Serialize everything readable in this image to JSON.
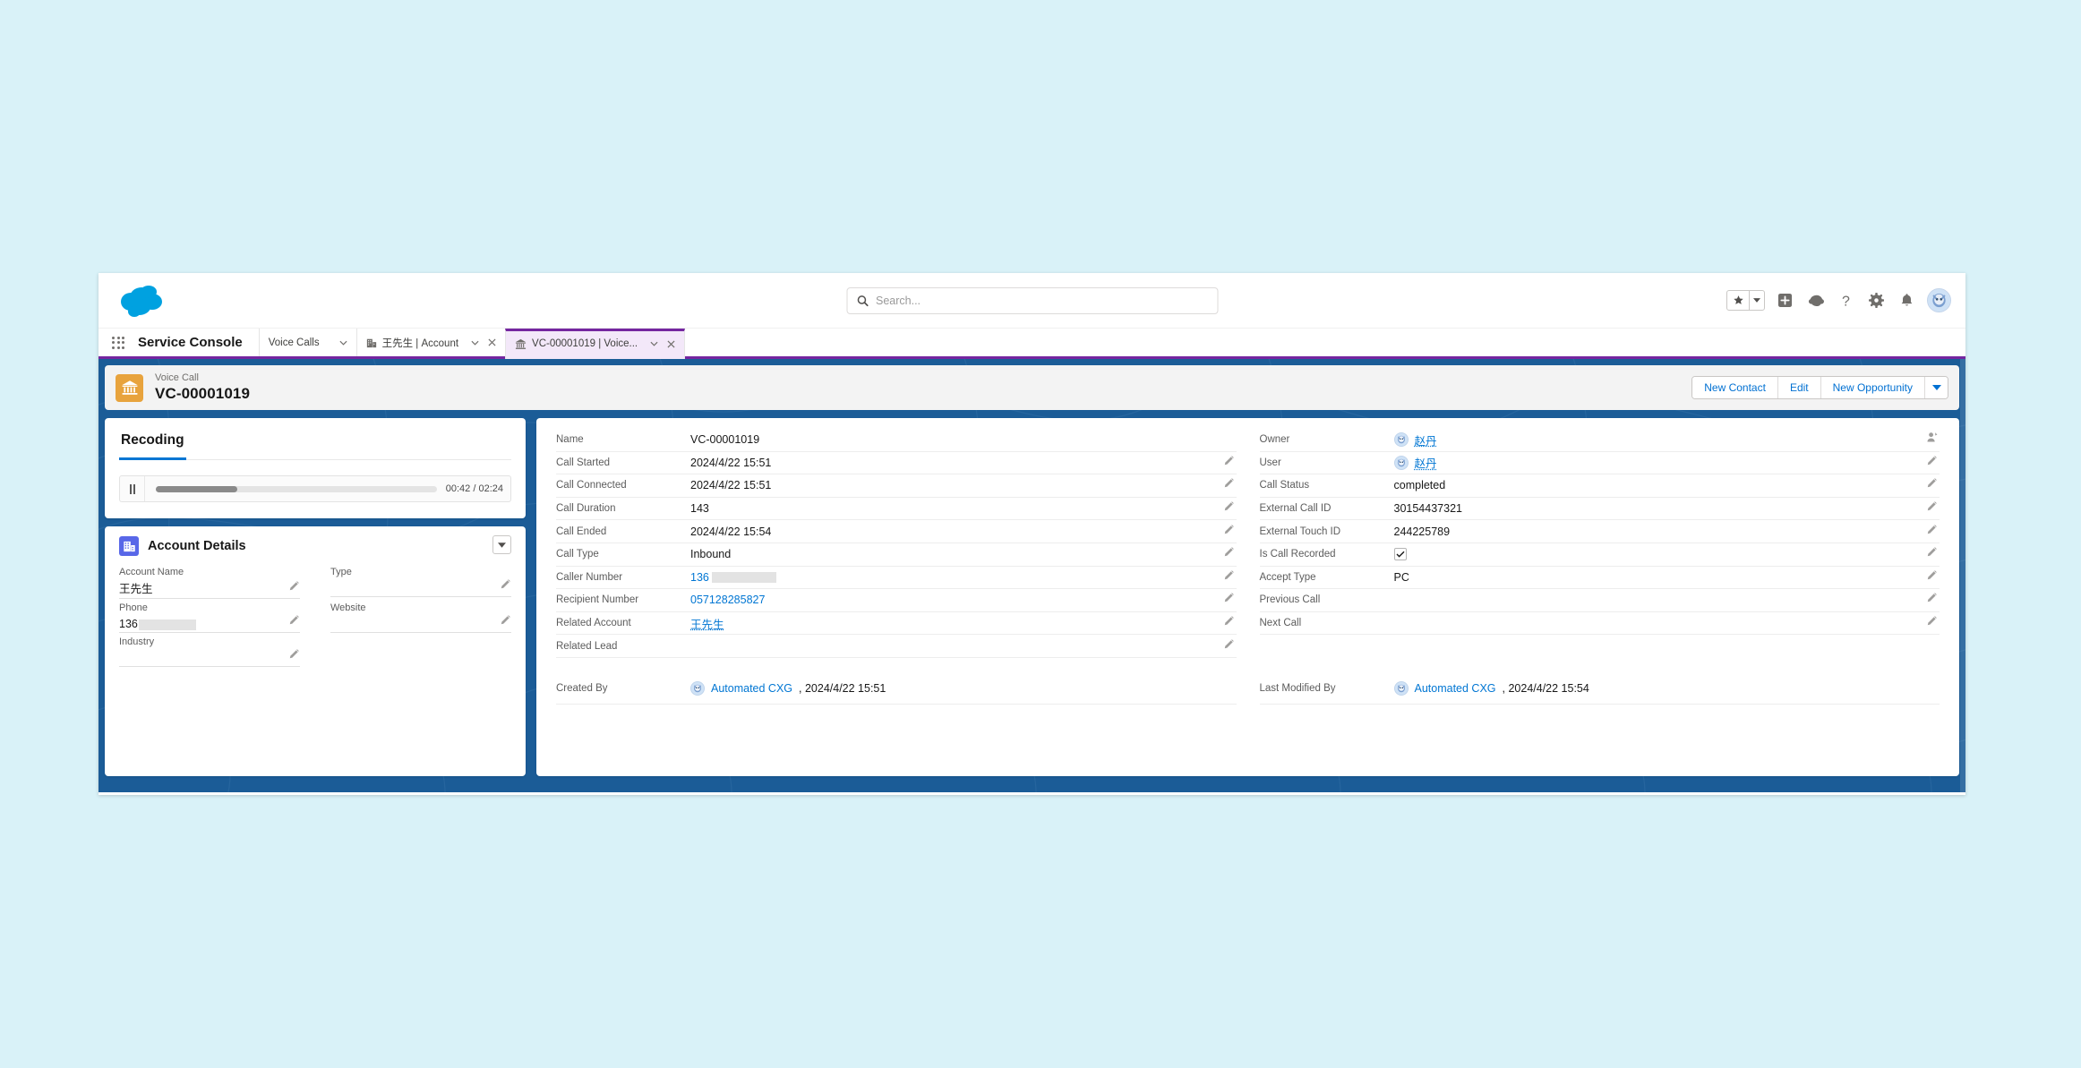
{
  "global_header": {
    "logo": "salesforce-cloud-logo",
    "search": {
      "placeholder": "Search...",
      "value": "",
      "icon": "search-icon"
    },
    "icons": [
      {
        "name": "favorites-star-icon",
        "glyph": "star"
      },
      {
        "name": "favorites-caret-icon",
        "glyph": "caret-down"
      },
      {
        "name": "global-actions-plus-icon",
        "glyph": "plus"
      },
      {
        "name": "einstein-icon",
        "glyph": "einstein"
      },
      {
        "name": "help-icon",
        "glyph": "question"
      },
      {
        "name": "setup-gear-icon",
        "glyph": "gear"
      },
      {
        "name": "notifications-bell-icon",
        "glyph": "bell"
      },
      {
        "name": "user-avatar",
        "glyph": "avatar"
      }
    ]
  },
  "console_nav": {
    "app_name": "Service Console",
    "waffle_label": "App Launcher",
    "items": [
      {
        "label": "Voice Calls",
        "icon": "",
        "active": false,
        "has_caret": true,
        "has_close": false
      },
      {
        "label": "王先生 | Account",
        "icon": "account-icon",
        "active": false,
        "has_caret": true,
        "has_close": true
      },
      {
        "label": "VC-00001019 | Voice...",
        "icon": "voice-call-icon",
        "active": true,
        "has_caret": true,
        "has_close": true
      }
    ]
  },
  "record_header": {
    "object_label": "Voice Call",
    "record_name": "VC-00001019",
    "icon": "voice-call-bank-icon",
    "actions": [
      {
        "label": "New Contact"
      },
      {
        "label": "Edit"
      },
      {
        "label": "New Opportunity"
      }
    ],
    "more_actions_icon": "caret-down-icon"
  },
  "recording_panel": {
    "tab_label": "Recoding",
    "player": {
      "pause_icon": "pause-icon",
      "progress_percent": 29,
      "time_label": "00:42 / 02:24",
      "current_time": "00:42",
      "total_time": "02:24"
    }
  },
  "account_details": {
    "title": "Account Details",
    "icon": "account-building-icon",
    "collapse_icon": "caret-down-icon",
    "fields": [
      {
        "label": "Account Name",
        "value": "王先生",
        "redacted": false,
        "editable": true
      },
      {
        "label": "Type",
        "value": "",
        "redacted": false,
        "editable": true
      },
      {
        "label": "Phone",
        "value": "136",
        "redacted": true,
        "editable": true
      },
      {
        "label": "Website",
        "value": "",
        "redacted": false,
        "editable": true
      },
      {
        "label": "Industry",
        "value": "",
        "redacted": false,
        "editable": true
      }
    ]
  },
  "detail_panel": {
    "left_fields": [
      {
        "label": "Name",
        "value": "VC-00001019",
        "type": "text",
        "editable": false
      },
      {
        "label": "Call Started",
        "value": "2024/4/22 15:51",
        "type": "text",
        "editable": true
      },
      {
        "label": "Call Connected",
        "value": "2024/4/22 15:51",
        "type": "text",
        "editable": true
      },
      {
        "label": "Call Duration",
        "value": "143",
        "type": "text",
        "editable": true
      },
      {
        "label": "Call Ended",
        "value": "2024/4/22 15:54",
        "type": "text",
        "editable": true
      },
      {
        "label": "Call Type",
        "value": "Inbound",
        "type": "text",
        "editable": true
      },
      {
        "label": "Caller Number",
        "value": "136",
        "type": "link-redacted",
        "editable": true
      },
      {
        "label": "Recipient Number",
        "value": "057128285827",
        "type": "link",
        "editable": true
      },
      {
        "label": "Related Account",
        "value": "王先生",
        "type": "link-underline",
        "editable": true
      },
      {
        "label": "Related Lead",
        "value": "",
        "type": "text",
        "editable": true
      }
    ],
    "right_fields": [
      {
        "label": "Owner",
        "value": "赵丹",
        "type": "user-link",
        "editable": true,
        "edit_icon": "change-owner-icon"
      },
      {
        "label": "User",
        "value": "赵丹",
        "type": "user-link",
        "editable": true
      },
      {
        "label": "Call Status",
        "value": "completed",
        "type": "text",
        "editable": true
      },
      {
        "label": "External Call ID",
        "value": "30154437321",
        "type": "text",
        "editable": true
      },
      {
        "label": "External Touch ID",
        "value": "244225789",
        "type": "text",
        "editable": true
      },
      {
        "label": "Is Call Recorded",
        "value": "",
        "type": "checkbox",
        "checked": true,
        "editable": true
      },
      {
        "label": "Accept Type",
        "value": "PC",
        "type": "text",
        "editable": true
      },
      {
        "label": "Previous Call",
        "value": "",
        "type": "text",
        "editable": true
      },
      {
        "label": "Next Call",
        "value": "",
        "type": "text",
        "editable": true
      }
    ],
    "system_fields": [
      {
        "label": "Created By",
        "user": "Automated CXG",
        "timestamp": "2024/4/22 15:51"
      },
      {
        "label": "Last Modified By",
        "user": "Automated CXG",
        "timestamp": "2024/4/22 15:54"
      }
    ]
  },
  "colors": {
    "brand_blue": "#0176d3",
    "link_blue": "#0070d2",
    "console_purple": "#7526a0",
    "workspace_blue": "#1b5c97",
    "record_icon_orange": "#e8a33d",
    "account_icon_indigo": "#5867e8",
    "page_background": "#d9f2f8"
  }
}
